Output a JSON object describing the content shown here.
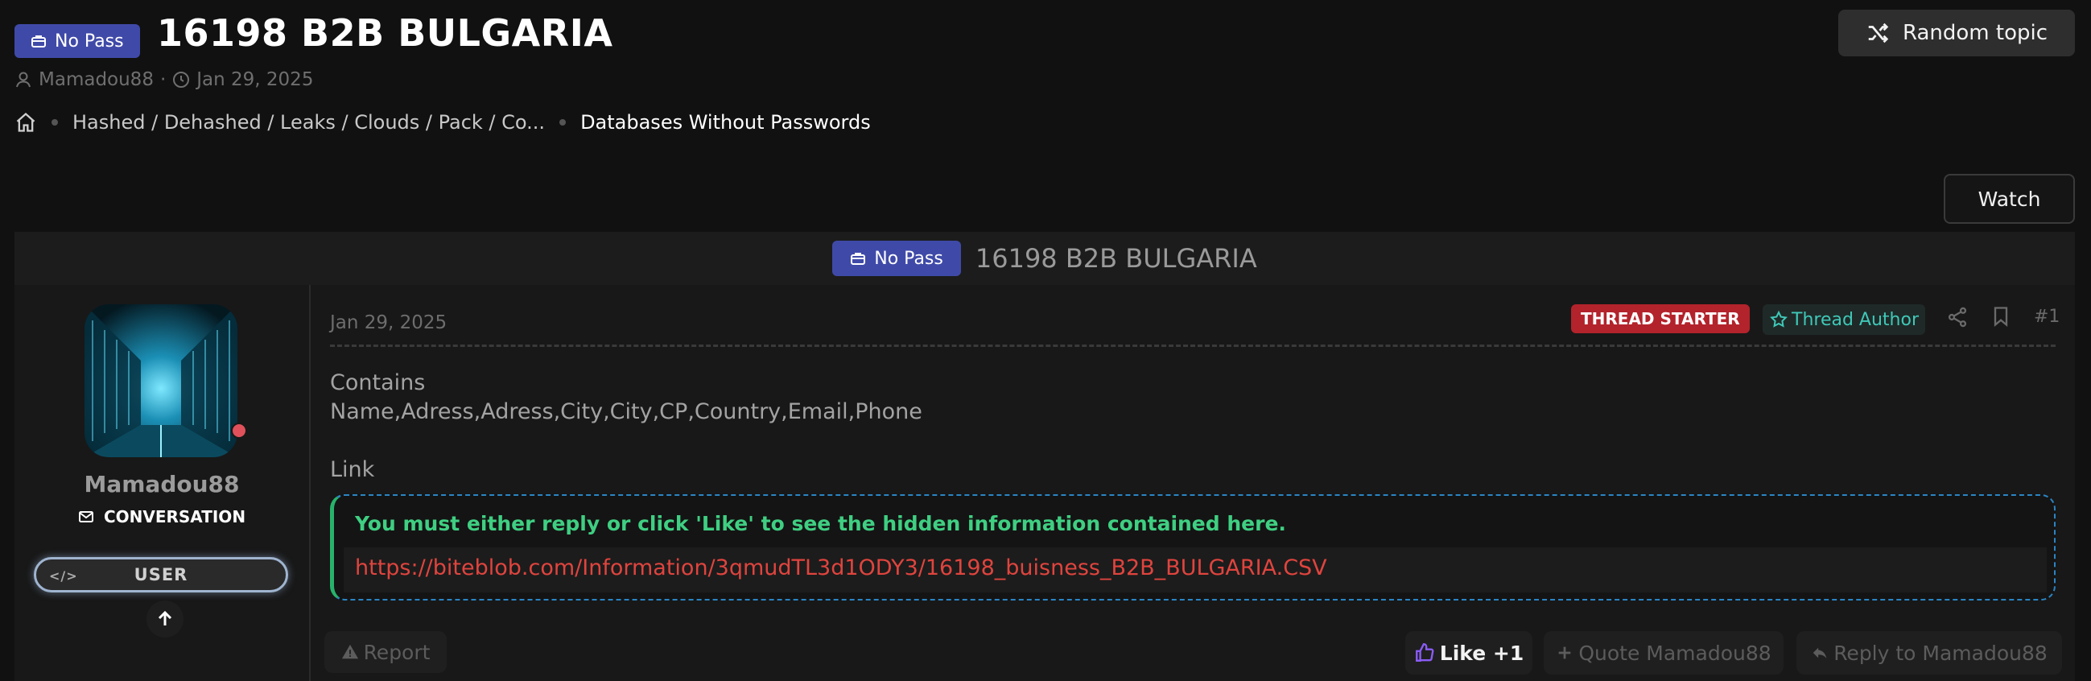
{
  "header": {
    "prefix": "No Pass",
    "title": "16198 B2B BULGARIA",
    "author": "Mamadou88",
    "separator": "·",
    "date": "Jan 29, 2025",
    "random_topic_label": "Random topic",
    "watch_label": "Watch"
  },
  "breadcrumb": {
    "items": [
      "Hashed / Dehashed / Leaks / Clouds / Pack / Co...",
      "Databases Without Passwords"
    ]
  },
  "thread": {
    "prefix": "No Pass",
    "title": "16198 B2B BULGARIA"
  },
  "user": {
    "name": "Mamadou88",
    "conversation_label": "CONVERSATION",
    "role": "USER",
    "role_code_glyph": "</>"
  },
  "post": {
    "date": "Jan 29, 2025",
    "thread_starter": "THREAD STARTER",
    "thread_author": "Thread Author",
    "number": "#1",
    "contains_label": "Contains",
    "fields": "Name,Adress,Adress,City,City,CP,Country,Email,Phone",
    "link_label": "Link",
    "hidden_message": "You must either reply or click 'Like' to see the hidden information contained here.",
    "hidden_link": "https://biteblob.com/Information/3qmudTL3d1ODY3/16198_buisness_B2B_BULGARIA.CSV"
  },
  "actions": {
    "report": "Report",
    "like": "Like +1",
    "quote": "Quote Mamadou88",
    "reply": "Reply to Mamadou88"
  },
  "colors": {
    "prefix_bg": "#3f4aa8",
    "starter_bg": "#b3232b",
    "author_text": "#3fc8b8",
    "hidden_msg": "#3fcf82",
    "hidden_link": "#e0443e",
    "like_icon": "#8b5cf6"
  },
  "icons": [
    "briefcase-icon",
    "user-icon",
    "clock-icon",
    "home-icon",
    "shuffle-icon",
    "envelope-icon",
    "code-icon",
    "arrow-up-icon",
    "star-icon",
    "share-icon",
    "bookmark-icon",
    "warning-icon",
    "thumbs-up-icon",
    "plus-icon",
    "reply-icon"
  ]
}
